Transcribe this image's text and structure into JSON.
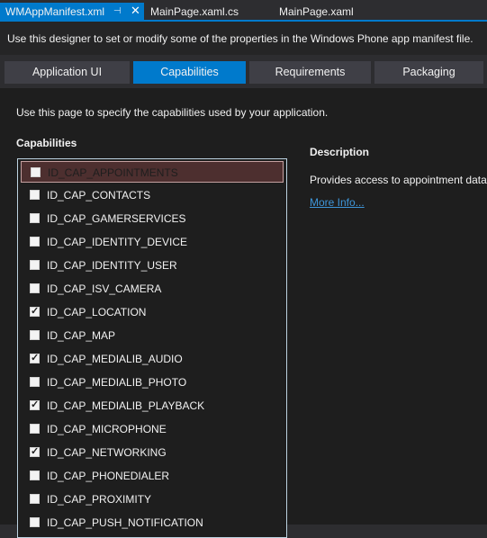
{
  "doc_tabs": [
    {
      "label": "WMAppManifest.xml",
      "active": true
    },
    {
      "label": "MainPage.xaml.cs",
      "active": false
    },
    {
      "label": "MainPage.xaml",
      "active": false
    }
  ],
  "icons": {
    "pin": "pin-icon",
    "close": "close-icon"
  },
  "info_bar": {
    "text": "Use this designer to set or modify some of the properties in the Windows Phone app manifest file."
  },
  "designer_tabs": [
    {
      "label": "Application UI",
      "selected": false
    },
    {
      "label": "Capabilities",
      "selected": true
    },
    {
      "label": "Requirements",
      "selected": false
    },
    {
      "label": "Packaging",
      "selected": false
    }
  ],
  "page": {
    "intro": "Use this page to specify the capabilities used by your application.",
    "capabilities_heading": "Capabilities",
    "description_heading": "Description",
    "description_text": "Provides access to appointment data.",
    "more_info": "More Info..."
  },
  "capabilities": [
    {
      "label": "ID_CAP_APPOINTMENTS",
      "checked": false,
      "selected": true
    },
    {
      "label": "ID_CAP_CONTACTS",
      "checked": false
    },
    {
      "label": "ID_CAP_GAMERSERVICES",
      "checked": false
    },
    {
      "label": "ID_CAP_IDENTITY_DEVICE",
      "checked": false
    },
    {
      "label": "ID_CAP_IDENTITY_USER",
      "checked": false
    },
    {
      "label": "ID_CAP_ISV_CAMERA",
      "checked": false
    },
    {
      "label": "ID_CAP_LOCATION",
      "checked": true
    },
    {
      "label": "ID_CAP_MAP",
      "checked": false
    },
    {
      "label": "ID_CAP_MEDIALIB_AUDIO",
      "checked": true
    },
    {
      "label": "ID_CAP_MEDIALIB_PHOTO",
      "checked": false
    },
    {
      "label": "ID_CAP_MEDIALIB_PLAYBACK",
      "checked": true
    },
    {
      "label": "ID_CAP_MICROPHONE",
      "checked": false
    },
    {
      "label": "ID_CAP_NETWORKING",
      "checked": true
    },
    {
      "label": "ID_CAP_PHONEDIALER",
      "checked": false
    },
    {
      "label": "ID_CAP_PROXIMITY",
      "checked": false
    },
    {
      "label": "ID_CAP_PUSH_NOTIFICATION",
      "checked": false
    }
  ],
  "colors": {
    "accent": "#007acc",
    "background": "#1e1e1e",
    "chrome": "#2d2d30",
    "selected_row": "#4d2f2f",
    "link": "#3e95d8"
  }
}
